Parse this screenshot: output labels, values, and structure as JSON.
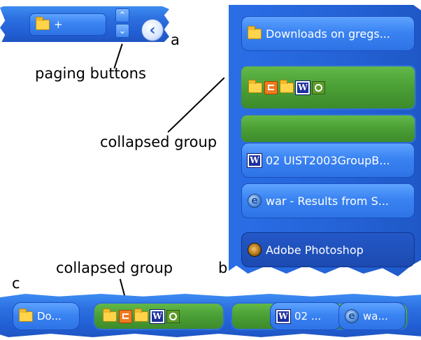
{
  "panel_a": {
    "letter": "a",
    "folder_button": {
      "icon": "folder-icon",
      "label": "+"
    },
    "pager_up_icon": "chevron-up-icon",
    "pager_down_icon": "chevron-down-icon",
    "back_icon": "chevron-left-icon",
    "callout": "paging buttons"
  },
  "panel_b": {
    "letter": "b",
    "items": [
      {
        "icon": "folder-icon",
        "label": "Downloads on gregs..."
      },
      {
        "icon": "word-icon",
        "label": "02 UIST2003GroupB..."
      },
      {
        "icon": "ie-icon",
        "label": "war - Results from S..."
      },
      {
        "icon": "photoshop-icon",
        "label": "Adobe Photoshop"
      }
    ],
    "group_icons": [
      "folder-icon",
      "powerpoint-icon",
      "folder-icon",
      "word-icon",
      "clock-icon"
    ],
    "callout": "collapsed group",
    "word_glyph": "W",
    "ie_glyph": "e"
  },
  "panel_c": {
    "letter": "c",
    "callout": "collapsed group",
    "items": [
      {
        "icon": "folder-icon",
        "label": "Do..."
      },
      {
        "icon": "word-icon",
        "label": "02 ..."
      },
      {
        "icon": "ie-icon",
        "label": "wa..."
      }
    ],
    "group_icons": [
      "folder-icon",
      "powerpoint-icon",
      "folder-icon",
      "word-icon",
      "clock-icon"
    ]
  },
  "colors": {
    "xp_blue": "#2462d6",
    "group_green": "#4a9f35",
    "active_dark": "#1c4ab0"
  }
}
